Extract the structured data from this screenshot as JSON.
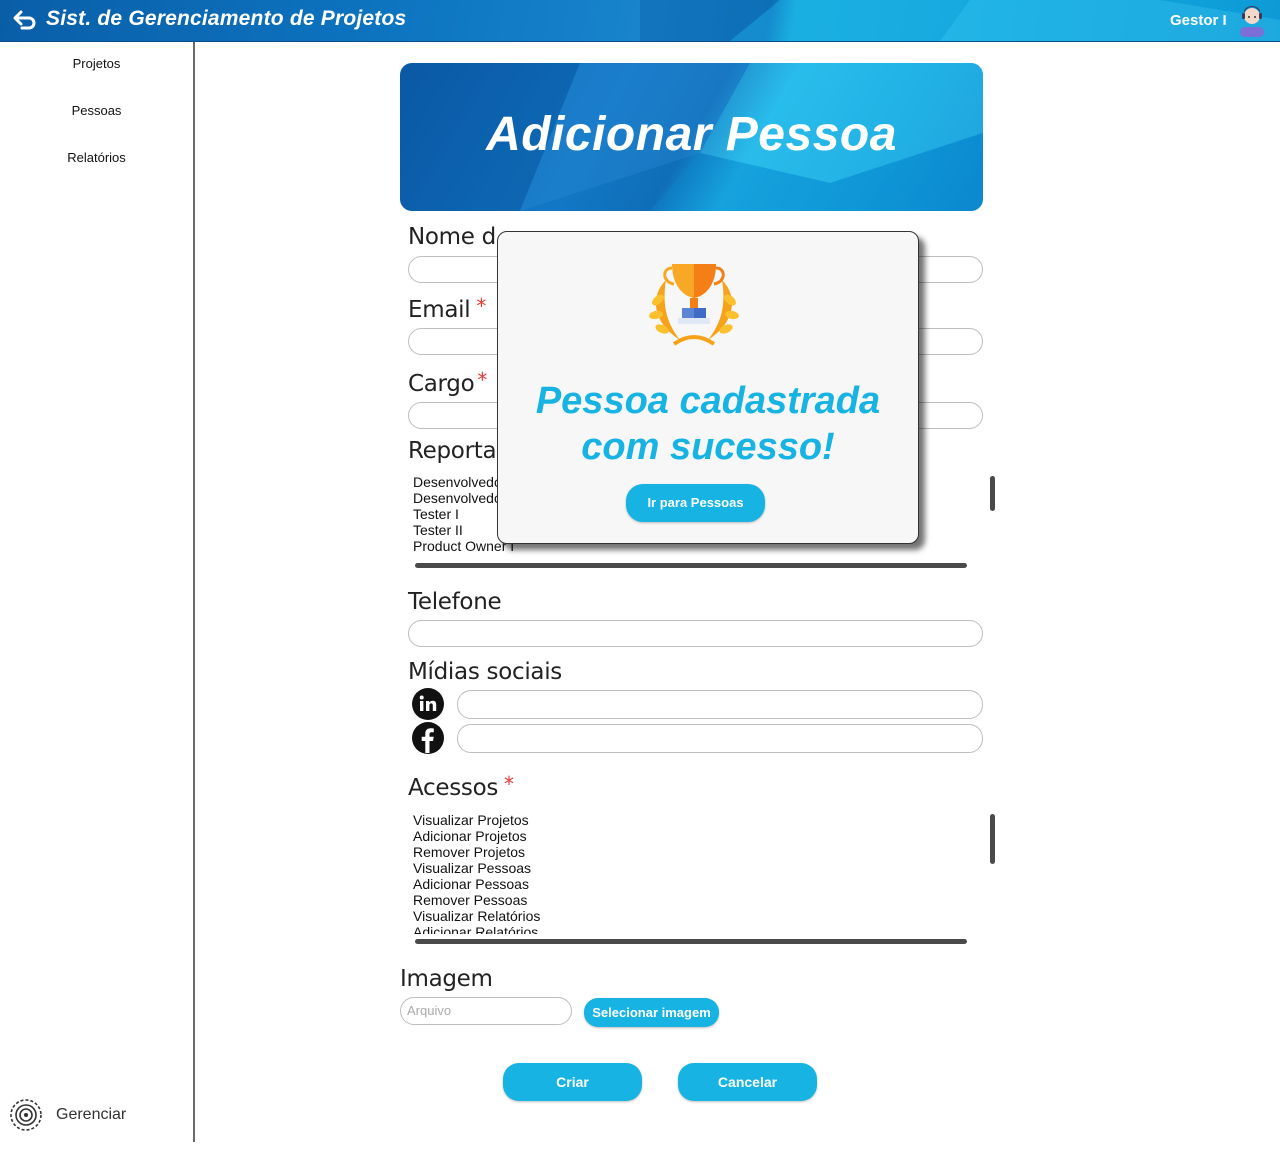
{
  "header": {
    "title": "Sist. de Gerenciamento de Projetos",
    "user": "Gestor I"
  },
  "sidebar": {
    "items": [
      {
        "label": "Projetos"
      },
      {
        "label": "Pessoas"
      },
      {
        "label": "Relatórios"
      }
    ],
    "manage_label": "Gerenciar"
  },
  "page": {
    "title": "Adicionar Pessoa"
  },
  "form": {
    "name_label": "Nome d",
    "email_label": "Email",
    "role_label": "Cargo",
    "reports_label": "Reporta",
    "reports_options": [
      "Desenvolvedo",
      "Desenvolvedo",
      "Tester I",
      "Tester II",
      "Product Owner I"
    ],
    "phone_label": "Telefone",
    "social_label": "Mídias sociais",
    "social_icons": [
      "linkedin-icon",
      "facebook-icon"
    ],
    "access_label": "Acessos",
    "access_options": [
      "Visualizar Projetos",
      "Adicionar Projetos",
      "Remover Projetos",
      "Visualizar Pessoas",
      "Adicionar Pessoas",
      "Remover Pessoas",
      "Visualizar Relatórios",
      "Adicionar Relatórios"
    ],
    "image_label": "Imagem",
    "file_placeholder": "Arquivo",
    "select_image_button": "Selecionar imagem",
    "create_button": "Criar",
    "cancel_button": "Cancelar",
    "required_mark": "*"
  },
  "modal": {
    "message_line1": "Pessoa cadastrada",
    "message_line2": "com sucesso!",
    "button": "Ir para Pessoas",
    "icon": "trophy-icon"
  },
  "colors": {
    "accent": "#17b3e3",
    "header_blue": "#0d74c0",
    "required": "#e53935"
  }
}
